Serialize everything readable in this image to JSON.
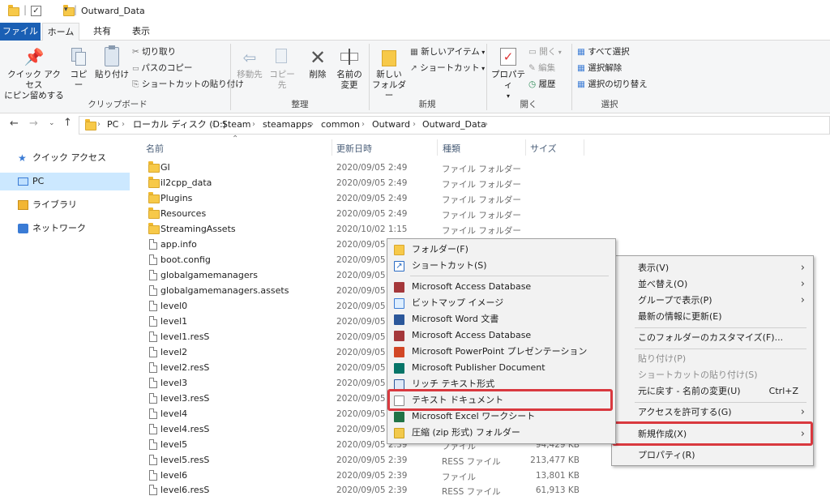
{
  "window": {
    "title": "Outward_Data"
  },
  "tabs": [
    {
      "label": "ファイル",
      "active": false,
      "primary": true
    },
    {
      "label": "ホーム",
      "active": true
    },
    {
      "label": "共有",
      "active": false
    },
    {
      "label": "表示",
      "active": false
    }
  ],
  "ribbon": {
    "clipboard": {
      "label": "クリップボード",
      "pin_line1": "クイック アクセス",
      "pin_line2": "にピン留めする",
      "copy": "コピー",
      "paste": "貼り付け",
      "cut": "切り取り",
      "copy_path": "パスのコピー",
      "paste_shortcut": "ショートカットの貼り付け"
    },
    "organize": {
      "label": "整理",
      "move_to": "移動先",
      "copy_to": "コピー先",
      "delete": "削除",
      "rename_line1": "名前の",
      "rename_line2": "変更"
    },
    "new": {
      "label": "新規",
      "new_folder_line1": "新しい",
      "new_folder_line2": "フォルダー",
      "new_item": "新しいアイテム",
      "easy_access": "ショートカット"
    },
    "open": {
      "label": "開く",
      "properties": "プロパティ",
      "open": "開く",
      "edit": "編集",
      "history": "履歴"
    },
    "select": {
      "label": "選択",
      "select_all": "すべて選択",
      "select_none": "選択解除",
      "invert": "選択の切り替え"
    }
  },
  "address": {
    "crumbs": [
      "PC",
      "ローカル ディスク (D:)",
      "Steam",
      "steamapps",
      "common",
      "Outward",
      "Outward_Data"
    ]
  },
  "nav": [
    {
      "label": "クイック アクセス",
      "icon": "star-icon",
      "selected": false
    },
    {
      "label": "PC",
      "icon": "pc-icon",
      "selected": true
    },
    {
      "label": "ライブラリ",
      "icon": "library-icon",
      "selected": false
    },
    {
      "label": "ネットワーク",
      "icon": "network-icon",
      "selected": false
    }
  ],
  "columns": {
    "name": "名前",
    "date": "更新日時",
    "type": "種類",
    "size": "サイズ"
  },
  "files": [
    {
      "name": "GI",
      "date": "2020/09/05 2:49",
      "type": "ファイル フォルダー",
      "size": "",
      "kind": "folder"
    },
    {
      "name": "il2cpp_data",
      "date": "2020/09/05 2:49",
      "type": "ファイル フォルダー",
      "size": "",
      "kind": "folder"
    },
    {
      "name": "Plugins",
      "date": "2020/09/05 2:49",
      "type": "ファイル フォルダー",
      "size": "",
      "kind": "folder"
    },
    {
      "name": "Resources",
      "date": "2020/09/05 2:49",
      "type": "ファイル フォルダー",
      "size": "",
      "kind": "folder"
    },
    {
      "name": "StreamingAssets",
      "date": "2020/10/02 1:15",
      "type": "ファイル フォルダー",
      "size": "",
      "kind": "folder"
    },
    {
      "name": "app.info",
      "date": "2020/09/05 2:39",
      "type": "",
      "size": "",
      "kind": "file"
    },
    {
      "name": "boot.config",
      "date": "2020/09/05 2:39",
      "type": "",
      "size": "",
      "kind": "file"
    },
    {
      "name": "globalgamemanagers",
      "date": "2020/09/05 2:39",
      "type": "",
      "size": "",
      "kind": "file"
    },
    {
      "name": "globalgamemanagers.assets",
      "date": "2020/09/05 2:39",
      "type": "",
      "size": "",
      "kind": "file"
    },
    {
      "name": "level0",
      "date": "2020/09/05 2:39",
      "type": "",
      "size": "",
      "kind": "file"
    },
    {
      "name": "level1",
      "date": "2020/09/05 2:39",
      "type": "",
      "size": "",
      "kind": "file"
    },
    {
      "name": "level1.resS",
      "date": "2020/09/05 2:39",
      "type": "",
      "size": "",
      "kind": "file"
    },
    {
      "name": "level2",
      "date": "2020/09/05 2:39",
      "type": "",
      "size": "",
      "kind": "file"
    },
    {
      "name": "level2.resS",
      "date": "2020/09/05 2:39",
      "type": "",
      "size": "",
      "kind": "file"
    },
    {
      "name": "level3",
      "date": "2020/09/05 2:39",
      "type": "",
      "size": "",
      "kind": "file"
    },
    {
      "name": "level3.resS",
      "date": "2020/09/05 2:39",
      "type": "",
      "size": "",
      "kind": "file"
    },
    {
      "name": "level4",
      "date": "2020/09/05 2:39",
      "type": "",
      "size": "",
      "kind": "file"
    },
    {
      "name": "level4.resS",
      "date": "2020/09/05 2:39",
      "type": "",
      "size": "",
      "kind": "file"
    },
    {
      "name": "level5",
      "date": "2020/09/05 2:39",
      "type": "ファイル",
      "size": "94,429 KB",
      "kind": "file"
    },
    {
      "name": "level5.resS",
      "date": "2020/09/05 2:39",
      "type": "RESS ファイル",
      "size": "213,477 KB",
      "kind": "file"
    },
    {
      "name": "level6",
      "date": "2020/09/05 2:39",
      "type": "ファイル",
      "size": "13,801 KB",
      "kind": "file"
    },
    {
      "name": "level6.resS",
      "date": "2020/09/05 2:39",
      "type": "RESS ファイル",
      "size": "61,913 KB",
      "kind": "file"
    }
  ],
  "context_menu": {
    "items": [
      {
        "label": "表示(V)",
        "submenu": true,
        "disabled": false
      },
      {
        "label": "並べ替え(O)",
        "submenu": true,
        "disabled": false
      },
      {
        "label": "グループで表示(P)",
        "submenu": true,
        "disabled": false
      },
      {
        "label": "最新の情報に更新(E)",
        "submenu": false,
        "disabled": false
      },
      {
        "label": "このフォルダーのカスタマイズ(F)...",
        "submenu": false,
        "disabled": false
      },
      {
        "label": "貼り付け(P)",
        "submenu": false,
        "disabled": true
      },
      {
        "label": "ショートカットの貼り付け(S)",
        "submenu": false,
        "disabled": true
      },
      {
        "label": "元に戻す - 名前の変更(U)",
        "shortcut": "Ctrl+Z",
        "submenu": false,
        "disabled": false
      },
      {
        "label": "アクセスを許可する(G)",
        "submenu": true,
        "disabled": false
      },
      {
        "label": "新規作成(X)",
        "submenu": true,
        "disabled": false,
        "highlighted": true
      },
      {
        "label": "プロパティ(R)",
        "submenu": false,
        "disabled": false
      }
    ]
  },
  "new_submenu": {
    "items": [
      {
        "label": "フォルダー(F)",
        "icon": "folder-icon",
        "color": "#f7c949"
      },
      {
        "label": "ショートカット(S)",
        "icon": "shortcut-icon",
        "color": "#2b6cc4"
      },
      {
        "label": "Microsoft Access Database",
        "icon": "access-icon",
        "color": "#a4373a"
      },
      {
        "label": "ビットマップ イメージ",
        "icon": "bitmap-icon",
        "color": "#3a7bd5"
      },
      {
        "label": "Microsoft Word 文書",
        "icon": "word-icon",
        "color": "#2b579a"
      },
      {
        "label": "Microsoft Access Database",
        "icon": "access-icon",
        "color": "#a4373a"
      },
      {
        "label": "Microsoft PowerPoint プレゼンテーション",
        "icon": "powerpoint-icon",
        "color": "#d24726"
      },
      {
        "label": "Microsoft Publisher Document",
        "icon": "publisher-icon",
        "color": "#077568"
      },
      {
        "label": "リッチ テキスト形式",
        "icon": "rtf-icon",
        "color": "#2b579a"
      },
      {
        "label": "テキスト ドキュメント",
        "icon": "text-document-icon",
        "color": "#ffffff",
        "highlighted": true
      },
      {
        "label": "Microsoft Excel ワークシート",
        "icon": "excel-icon",
        "color": "#217346"
      },
      {
        "label": "圧縮 (zip 形式) フォルダー",
        "icon": "zip-folder-icon",
        "color": "#f2c94c"
      }
    ]
  },
  "colors": {
    "highlight": "#d9393f",
    "selection": "#cce8ff",
    "tab_file": "#1a5fb4"
  }
}
